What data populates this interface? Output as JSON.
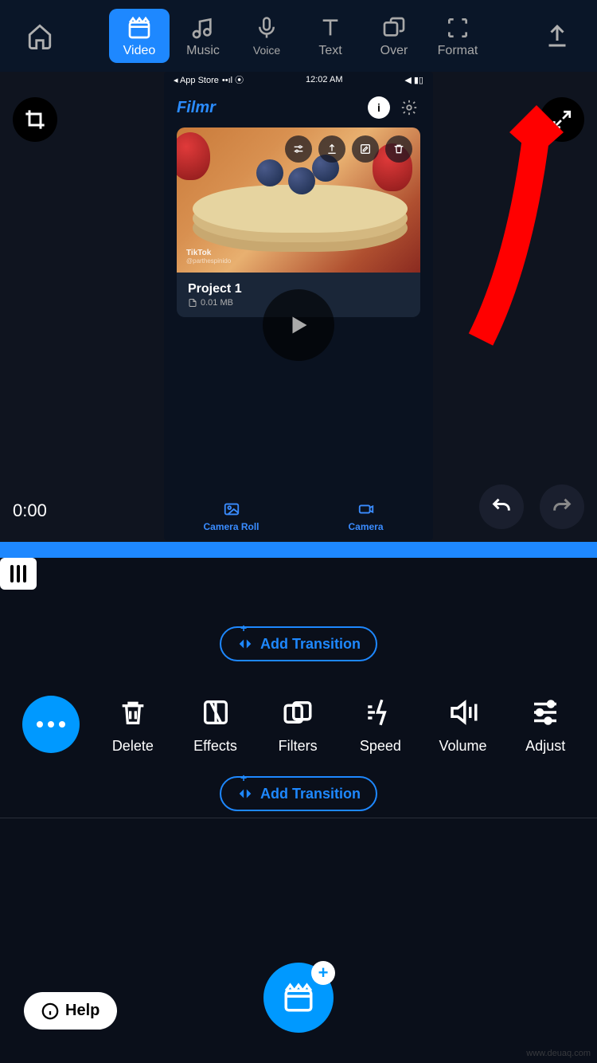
{
  "topbar": {
    "tabs": [
      {
        "label": "Video",
        "active": true
      },
      {
        "label": "Music",
        "active": false
      },
      {
        "label": "Voice",
        "active": false
      },
      {
        "label": "Text",
        "active": false
      },
      {
        "label": "Over",
        "active": false
      },
      {
        "label": "Format",
        "active": false
      }
    ]
  },
  "preview": {
    "timestamp": "0:00",
    "phone": {
      "statusbar_left": "◂ App Store",
      "statusbar_time": "12:02 AM",
      "app_title": "Filmr",
      "project_name": "Project 1",
      "project_size": "0.01 MB",
      "tiktok_label": "TikTok",
      "tiktok_user": "@parthespinido",
      "bottom": {
        "camera_roll": "Camera Roll",
        "camera": "Camera"
      }
    }
  },
  "timeline": {
    "add_transition": "Add Transition"
  },
  "tools": [
    {
      "label": "Delete"
    },
    {
      "label": "Effects"
    },
    {
      "label": "Filters"
    },
    {
      "label": "Speed"
    },
    {
      "label": "Volume"
    },
    {
      "label": "Adjust"
    }
  ],
  "help": {
    "label": "Help"
  },
  "watermark": "www.deuaq.com",
  "colors": {
    "accent": "#1e88ff",
    "bright": "#0099ff"
  }
}
